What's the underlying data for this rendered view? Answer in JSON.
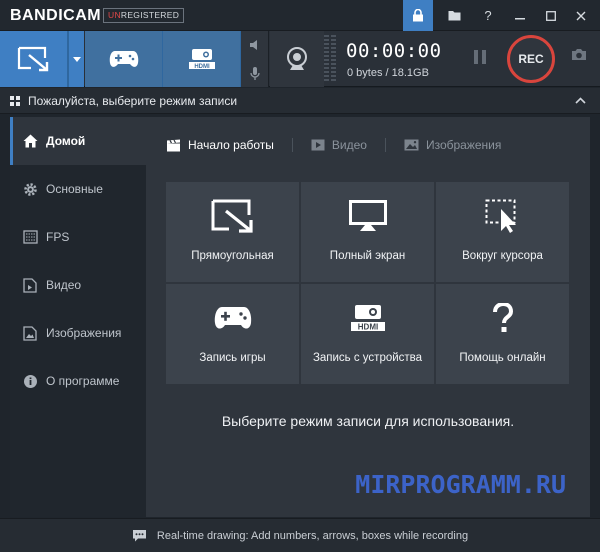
{
  "app": {
    "logo_main": "BANDI",
    "logo_cam": "CAM",
    "badge_un": "UN",
    "badge_rest": "REGISTERED"
  },
  "toolbar": {
    "timer": "00:00:00",
    "size": "0 bytes / 18.1GB",
    "rec_label": "REC"
  },
  "header": {
    "title": "Пожалуйста, выберите режим записи"
  },
  "sidebar": {
    "items": [
      {
        "label": "Домой",
        "icon": "home-icon"
      },
      {
        "label": "Основные",
        "icon": "gear-icon"
      },
      {
        "label": "FPS",
        "icon": "fps-icon"
      },
      {
        "label": "Видео",
        "icon": "video-file-icon"
      },
      {
        "label": "Изображения",
        "icon": "image-file-icon"
      },
      {
        "label": "О программе",
        "icon": "info-icon"
      }
    ]
  },
  "tabs": [
    {
      "label": "Начало работы",
      "icon": "clapperboard-icon"
    },
    {
      "label": "Видео",
      "icon": "play-icon"
    },
    {
      "label": "Изображения",
      "icon": "image-icon"
    }
  ],
  "tiles": [
    {
      "label": "Прямоугольная",
      "icon": "rectangle-select-icon"
    },
    {
      "label": "Полный экран",
      "icon": "monitor-icon"
    },
    {
      "label": "Вокруг курсора",
      "icon": "cursor-area-icon"
    },
    {
      "label": "Запись игры",
      "icon": "gamepad-icon"
    },
    {
      "label": "Запись с устройства",
      "icon": "hdmi-icon"
    },
    {
      "label": "Помощь онлайн",
      "icon": "help-icon"
    }
  ],
  "main": {
    "hint": "Выберите режим записи для использования.",
    "watermark": "MIRPROGRAMM.RU"
  },
  "footer": {
    "tip": "Real-time drawing: Add numbers, arrows, boxes while recording"
  },
  "colors": {
    "accent": "#3f7fc3",
    "rec_ring": "#d9453d",
    "watermark": "#3c63c8"
  }
}
